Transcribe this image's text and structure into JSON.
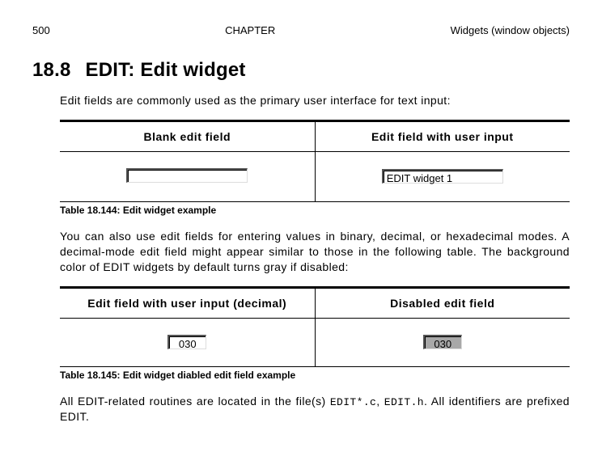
{
  "header": {
    "page_number": "500",
    "chapter_label": "CHAPTER",
    "chapter_title": "Widgets (window objects)"
  },
  "section": {
    "number": "18.8",
    "title": "EDIT: Edit widget"
  },
  "intro_text": "Edit fields are commonly used as the primary user interface for text input:",
  "table1": {
    "col1_header": "Blank edit field",
    "col2_header": "Edit field with user input",
    "blank_value": "",
    "user_value": "EDIT widget 1",
    "caption": "Table 18.144: Edit widget example"
  },
  "para2": "You can also use edit fields for entering values in binary, decimal, or hexadecimal modes. A decimal-mode edit field might appear similar to those in the following table. The background color of EDIT widgets by default turns gray if disabled:",
  "table2": {
    "col1_header": "Edit field with user input (decimal)",
    "col2_header": "Disabled edit field",
    "decimal_value": "030",
    "disabled_value": "030",
    "caption": "Table 18.145: Edit widget diabled edit field example"
  },
  "para3_pre": "All EDIT-related routines are located in the file(s) ",
  "para3_code1": "EDIT*.c",
  "para3_mid": ", ",
  "para3_code2": "EDIT.h",
  "para3_post": ". All identifiers are prefixed EDIT."
}
